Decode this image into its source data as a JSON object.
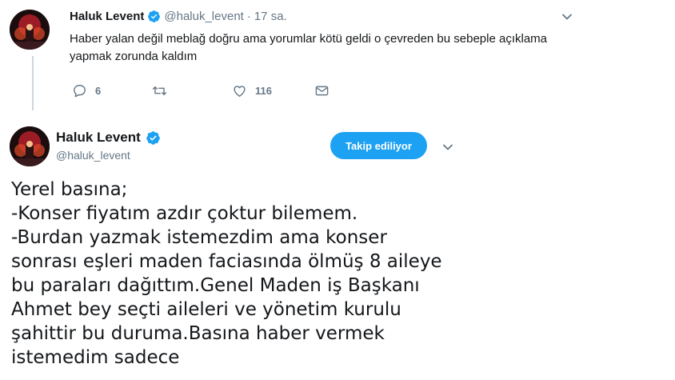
{
  "reply_tweet": {
    "author_name": "Haluk Levent",
    "handle": "@haluk_levent",
    "separator": "·",
    "time": "17 sa.",
    "text": "Haber yalan değil meblağ doğru ama yorumlar kötü geldi o çevreden bu sebeple açıklama yapmak zorunda kaldım",
    "reply_count": "6",
    "retweet_count": "",
    "like_count": "116"
  },
  "main_tweet": {
    "author_name": "Haluk Levent",
    "handle": "@haluk_levent",
    "follow_label": "Takip ediliyor",
    "lines": [
      "Yerel basına;",
      "-Konser fiyatım azdır çoktur bilemem.",
      "-Burdan yazmak istemezdim ama konser",
      "sonrası eşleri maden faciasında ölmüş 8 aileye",
      "bu paraları dağıttım.Genel Maden iş Başkanı",
      "Ahmet bey seçti aileleri ve yönetim kurulu",
      "şahittir bu duruma.Basına haber vermek",
      "istemedim sadece"
    ]
  },
  "colors": {
    "accent": "#1da1f2",
    "muted": "#657786",
    "text": "#14171a",
    "thread_line": "#ccd6dd"
  },
  "icons": {
    "verified": "verified-badge-icon",
    "caret": "chevron-down-icon",
    "reply": "reply-icon",
    "retweet": "retweet-icon",
    "like": "heart-icon",
    "dm": "envelope-icon"
  }
}
